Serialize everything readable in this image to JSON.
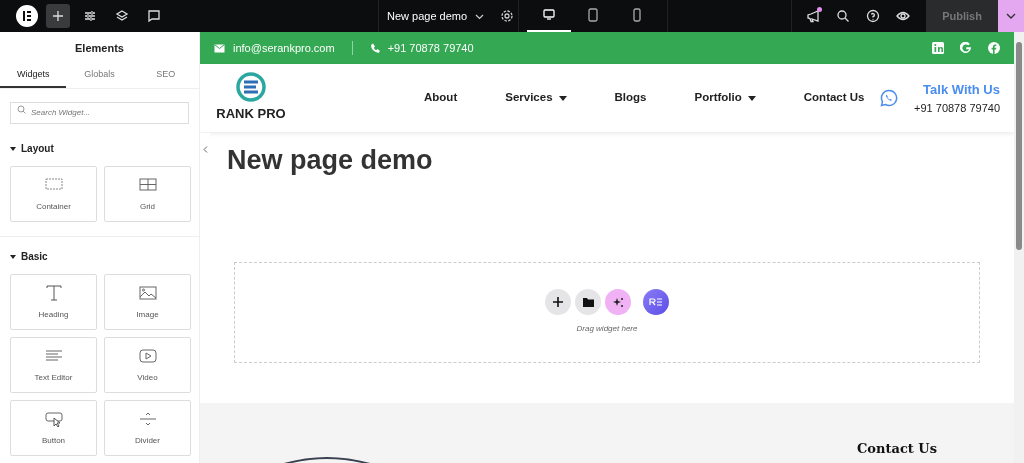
{
  "topbar": {
    "tools": [
      {
        "selected": true
      },
      {
        "selected": false
      },
      {
        "selected": false
      },
      {
        "selected": false
      }
    ],
    "page_title": "New page demo",
    "devices": [
      {
        "selected": true
      },
      {
        "selected": false
      },
      {
        "selected": false
      }
    ],
    "has_notification": true,
    "publish": "Publish"
  },
  "sidebar": {
    "title": "Elements",
    "tabs": [
      {
        "label": "Widgets",
        "selected": true
      },
      {
        "label": "Globals",
        "selected": false
      },
      {
        "label": "SEO",
        "selected": false
      }
    ],
    "search": {
      "placeholder": "Search Widget..."
    },
    "categories": [
      {
        "name": "Layout",
        "expanded": true,
        "widgets": [
          {
            "label": "Container",
            "kind": "container"
          },
          {
            "label": "Grid",
            "kind": "grid"
          }
        ]
      },
      {
        "name": "Basic",
        "expanded": true,
        "widgets": [
          {
            "label": "Heading",
            "kind": "heading"
          },
          {
            "label": "Image",
            "kind": "image"
          },
          {
            "label": "Text Editor",
            "kind": "text"
          },
          {
            "label": "Video",
            "kind": "video"
          },
          {
            "label": "Button",
            "kind": "button"
          },
          {
            "label": "Divider",
            "kind": "divider"
          }
        ]
      }
    ]
  },
  "site": {
    "contact_bar": {
      "email": "info@serankpro.com",
      "phone": "+91 70878 79740"
    },
    "header": {
      "logo_text": "RANK PRO",
      "nav": [
        {
          "label": "About",
          "has_dropdown": false
        },
        {
          "label": "Services",
          "has_dropdown": true
        },
        {
          "label": "Blogs",
          "has_dropdown": false
        },
        {
          "label": "Portfolio",
          "has_dropdown": true
        },
        {
          "label": "Contact Us",
          "has_dropdown": false
        }
      ],
      "cta": {
        "title": "Talk With Us",
        "phone": "+91 70878 79740"
      }
    },
    "page_title": "New page demo",
    "dropzone": {
      "hint": "Drag widget here"
    },
    "footer": {
      "heading": "Contact Us"
    }
  }
}
